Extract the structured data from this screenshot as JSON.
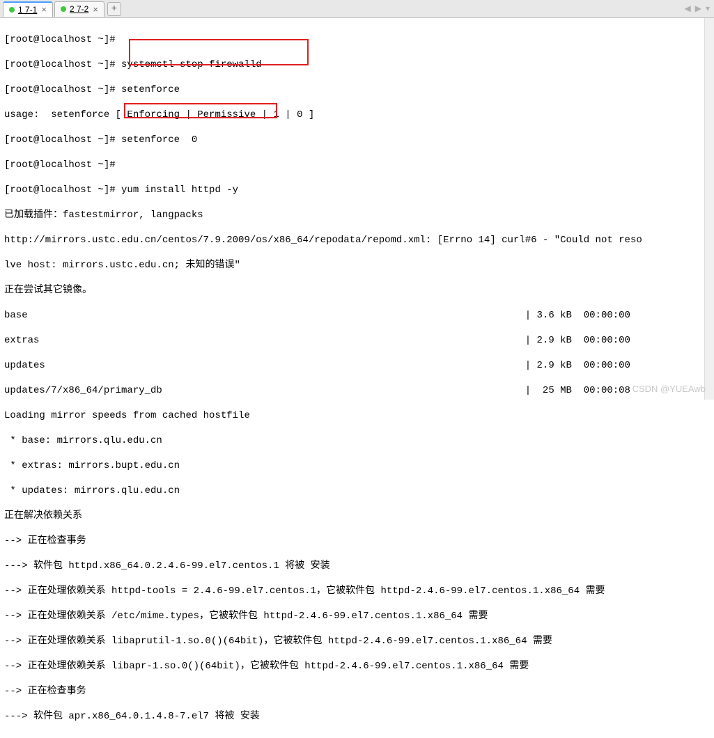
{
  "tabs": {
    "t1_label": "1 7-1",
    "t2_label": "2 7-2",
    "add": "+"
  },
  "nav": {
    "left": "◀",
    "right": "▶",
    "down": "▾"
  },
  "term": {
    "l1": "[root@localhost ~]#",
    "l2": "[root@localhost ~]# systemctl stop firewalld",
    "l3": "[root@localhost ~]# setenforce",
    "l4": "usage:  setenforce [ Enforcing | Permissive | 1 | 0 ]",
    "l5": "[root@localhost ~]# setenforce  0",
    "l6": "[root@localhost ~]#",
    "l7": "[root@localhost ~]# yum install httpd -y",
    "l8": "已加载插件：fastestmirror, langpacks",
    "l9": "http://mirrors.ustc.edu.cn/centos/7.9.2009/os/x86_64/repodata/repomd.xml: [Errno 14] curl#6 - \"Could not reso",
    "l10": "lve host: mirrors.ustc.edu.cn; 未知的错误\"",
    "l11": "正在尝试其它镜像。",
    "l12": "base                                                                                     | 3.6 kB  00:00:00",
    "l13": "extras                                                                                   | 2.9 kB  00:00:00",
    "l14": "updates                                                                                  | 2.9 kB  00:00:00",
    "l15": "updates/7/x86_64/primary_db                                                              |  25 MB  00:00:08",
    "l16": "Loading mirror speeds from cached hostfile",
    "l17": " * base: mirrors.qlu.edu.cn",
    "l18": " * extras: mirrors.bupt.edu.cn",
    "l19": " * updates: mirrors.qlu.edu.cn",
    "l20": "正在解决依赖关系",
    "l21": "--> 正在检查事务",
    "l22": "---> 软件包 httpd.x86_64.0.2.4.6-99.el7.centos.1 将被 安装",
    "l23": "--> 正在处理依赖关系 httpd-tools = 2.4.6-99.el7.centos.1，它被软件包 httpd-2.4.6-99.el7.centos.1.x86_64 需要",
    "l24": "--> 正在处理依赖关系 /etc/mime.types，它被软件包 httpd-2.4.6-99.el7.centos.1.x86_64 需要",
    "l25": "--> 正在处理依赖关系 libaprutil-1.so.0()(64bit)，它被软件包 httpd-2.4.6-99.el7.centos.1.x86_64 需要",
    "l26": "--> 正在处理依赖关系 libapr-1.so.0()(64bit)，它被软件包 httpd-2.4.6-99.el7.centos.1.x86_64 需要",
    "l27": "--> 正在检查事务",
    "l28": "---> 软件包 apr.x86_64.0.1.4.8-7.el7 将被 安装"
  },
  "watermark": "CSDN @YUEAwb"
}
